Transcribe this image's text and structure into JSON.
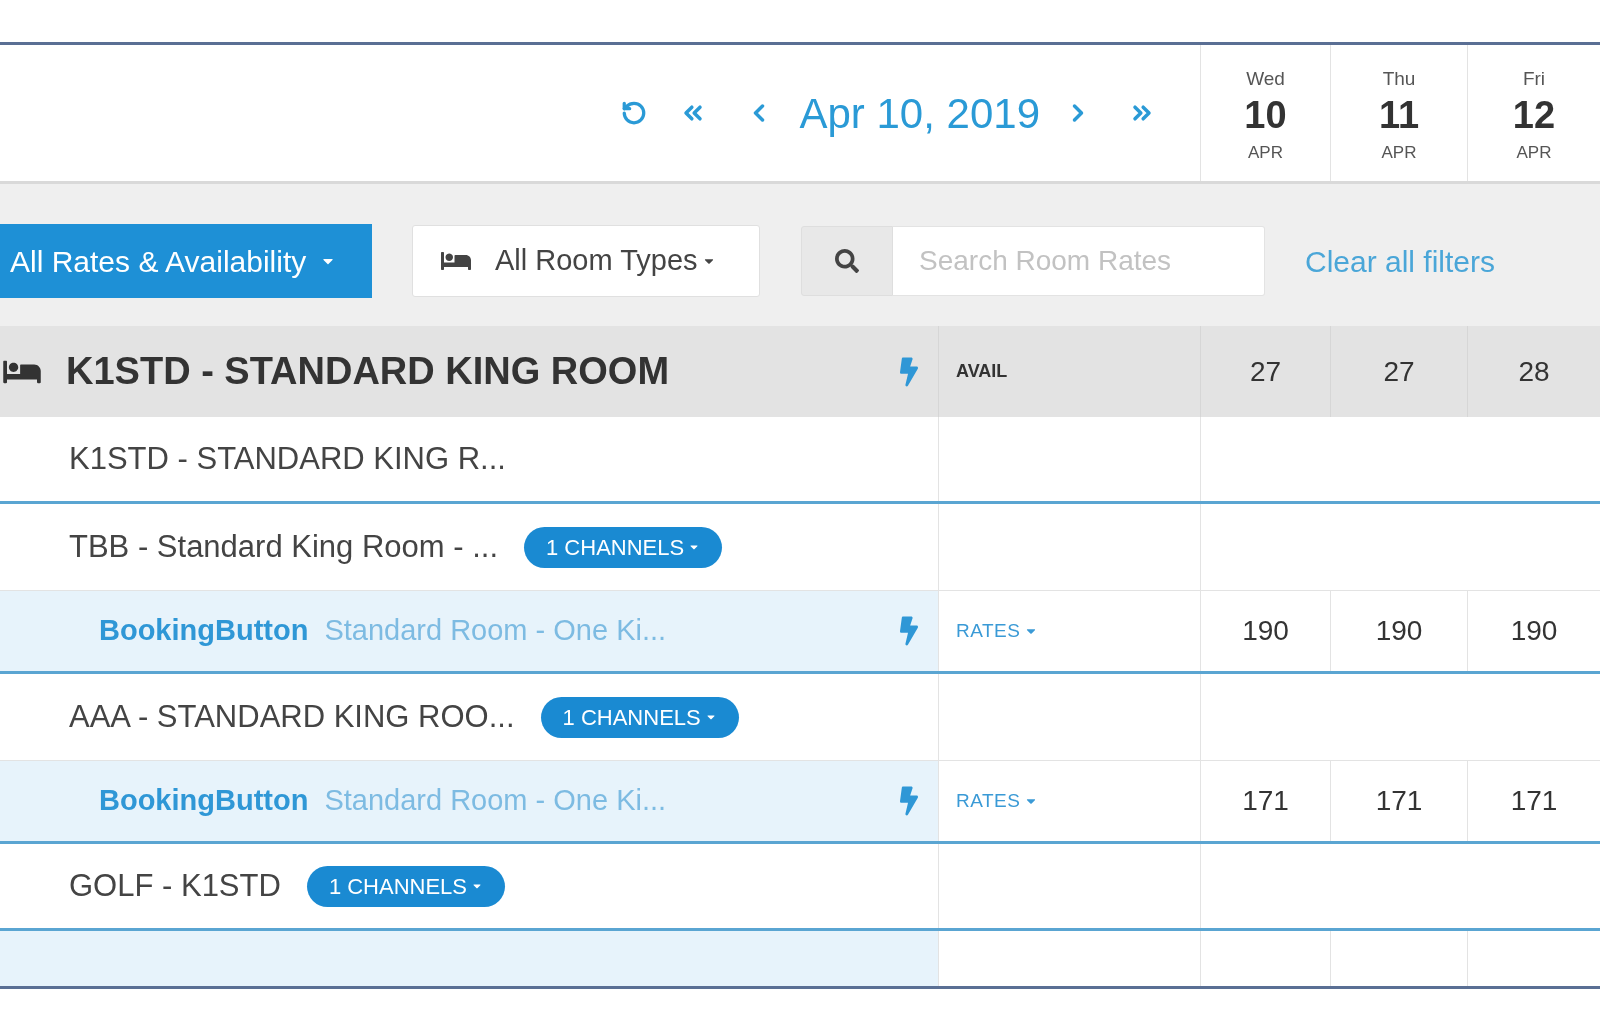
{
  "date_nav": {
    "current_date": "Apr 10, 2019"
  },
  "days": [
    {
      "weekday": "Wed",
      "day": "10",
      "month": "APR"
    },
    {
      "weekday": "Thu",
      "day": "11",
      "month": "APR"
    },
    {
      "weekday": "Fri",
      "day": "12",
      "month": "APR"
    }
  ],
  "filters": {
    "view_button": "All Rates & Availability",
    "room_type_button": "All Room Types",
    "search": {
      "placeholder": "Search Room Rates"
    },
    "clear_link": "Clear all filters"
  },
  "room_type": {
    "title": "K1STD - STANDARD KING ROOM",
    "type_label": "AVAIL",
    "values": [
      "27",
      "27",
      "28"
    ]
  },
  "rate_plans": [
    {
      "name": "K1STD - STANDARD KING R..."
    },
    {
      "name": "TBB - Standard King Room - ...",
      "channels_button": "1 CHANNELS",
      "channels": [
        {
          "channel": "BookingButton",
          "name": "Standard Room - One Ki...",
          "type_label": "RATES",
          "values": [
            "190",
            "190",
            "190"
          ]
        }
      ]
    },
    {
      "name": "AAA - STANDARD KING ROO...",
      "channels_button": "1 CHANNELS",
      "channels": [
        {
          "channel": "BookingButton",
          "name": "Standard Room - One Ki...",
          "type_label": "RATES",
          "values": [
            "171",
            "171",
            "171"
          ]
        }
      ]
    },
    {
      "name": "GOLF - K1STD",
      "channels_button": "1 CHANNELS"
    }
  ]
}
